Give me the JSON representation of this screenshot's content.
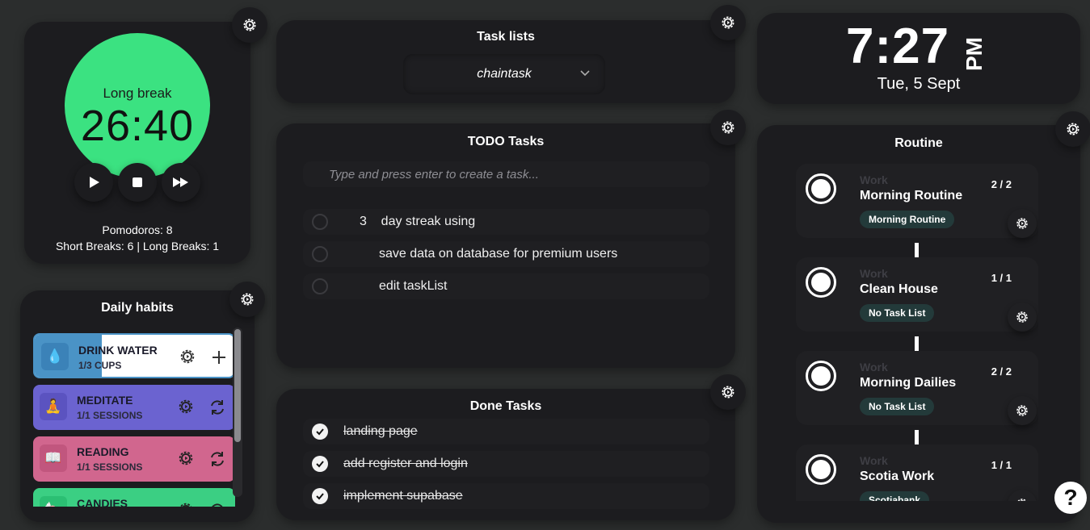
{
  "pomodoro": {
    "mode": "Long break",
    "time": "26:40",
    "pomodoros_label": "Pomodoros: 8",
    "breaks_label": "Short Breaks: 6 | Long Breaks: 1",
    "accent": "#3be281"
  },
  "habits": {
    "title": "Daily habits",
    "items": [
      {
        "name": "DRINK WATER",
        "sub": "1/3 CUPS",
        "icon": "💧",
        "color": "#4a93c6",
        "progress": 0.33,
        "action": "plus"
      },
      {
        "name": "MEDITATE",
        "sub": "1/1 SESSIONS",
        "icon": "🧘",
        "color": "#6b63d0",
        "progress": 1.0,
        "action": "refresh"
      },
      {
        "name": "READING",
        "sub": "1/1 SESSIONS",
        "icon": "📖",
        "color": "#d1668e",
        "progress": 1.0,
        "action": "refresh"
      },
      {
        "name": "CANDIES",
        "sub": "",
        "icon": "🍬",
        "color": "#3bcf83",
        "progress": 1.0,
        "action": "refresh"
      }
    ]
  },
  "task_lists": {
    "title": "Task lists",
    "selected": "chaintask"
  },
  "todo": {
    "title": "TODO Tasks",
    "placeholder": "Type and press enter to create a task...",
    "tasks": [
      {
        "text": "3    day streak using"
      },
      {
        "text": "save data on database for premium users"
      },
      {
        "text": "edit taskList"
      }
    ]
  },
  "done": {
    "title": "Done Tasks",
    "tasks": [
      {
        "text": "landing page"
      },
      {
        "text": "add register and login"
      },
      {
        "text": "implement supabase"
      }
    ]
  },
  "clock": {
    "time": "7:27",
    "ampm": "PM",
    "date": "Tue, 5 Sept"
  },
  "routine": {
    "title": "Routine",
    "items": [
      {
        "category": "Work",
        "name": "Morning Routine",
        "tag": "Morning Routine",
        "count": "2 / 2"
      },
      {
        "category": "Work",
        "name": "Clean House",
        "tag": "No Task List",
        "count": "1 / 1"
      },
      {
        "category": "Work",
        "name": "Morning Dailies",
        "tag": "No Task List",
        "count": "2 / 2"
      },
      {
        "category": "Work",
        "name": "Scotia Work",
        "tag": "Scotiabank",
        "count": "1 / 1"
      }
    ]
  },
  "help_label": "?"
}
